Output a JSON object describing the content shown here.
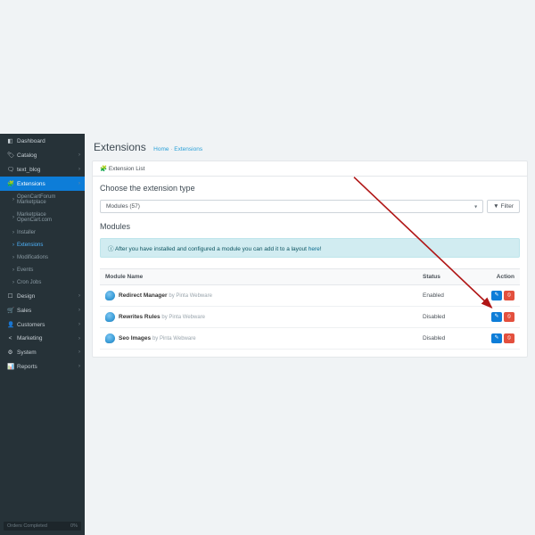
{
  "sidebar": {
    "items": [
      {
        "icon": "◧",
        "label": "Dashboard"
      },
      {
        "icon": "🏷",
        "label": "Catalog",
        "chev": true
      },
      {
        "icon": "🗨",
        "label": "text_blog",
        "chev": true
      },
      {
        "icon": "🧩",
        "label": "Extensions",
        "chev": true,
        "active": true
      },
      {
        "icon": "☐",
        "label": "Design",
        "chev": true
      },
      {
        "icon": "🛒",
        "label": "Sales",
        "chev": true
      },
      {
        "icon": "👤",
        "label": "Customers",
        "chev": true
      },
      {
        "icon": "<",
        "label": "Marketing",
        "chev": true
      },
      {
        "icon": "⚙",
        "label": "System",
        "chev": true
      },
      {
        "icon": "📊",
        "label": "Reports",
        "chev": true
      }
    ],
    "subs": [
      {
        "label": "OpenCartForum Marketplace"
      },
      {
        "label": "Marketplace OpenCart.com"
      },
      {
        "label": "Installer"
      },
      {
        "label": "Extensions",
        "active": true
      },
      {
        "label": "Modifications"
      },
      {
        "label": "Events"
      },
      {
        "label": "Cron Jobs"
      }
    ],
    "footer": {
      "label": "Orders Completed",
      "value": "0%"
    }
  },
  "page": {
    "title": "Extensions",
    "crumb_home": "Home",
    "crumb_current": "Extensions"
  },
  "panel1": {
    "title": "Extension List"
  },
  "section": {
    "choose": "Choose the extension type",
    "select_value": "Modules (57)",
    "filter_label": "Filter",
    "modules_title": "Modules"
  },
  "alert": {
    "icon": "ⓘ",
    "text": "After you have installed and configured a module you can add it to a layout ",
    "link": "here",
    "excl": "!"
  },
  "table": {
    "col1": "Module Name",
    "col2": "Status",
    "col3": "Action",
    "rows": [
      {
        "name": "Redirect Manager",
        "vendor": "by Pinta Webware",
        "status": "Enabled"
      },
      {
        "name": "Rewrites Rules",
        "vendor": "by Pinta Webware",
        "status": "Disabled"
      },
      {
        "name": "Seo Images",
        "vendor": "by Pinta Webware",
        "status": "Disabled"
      }
    ]
  }
}
